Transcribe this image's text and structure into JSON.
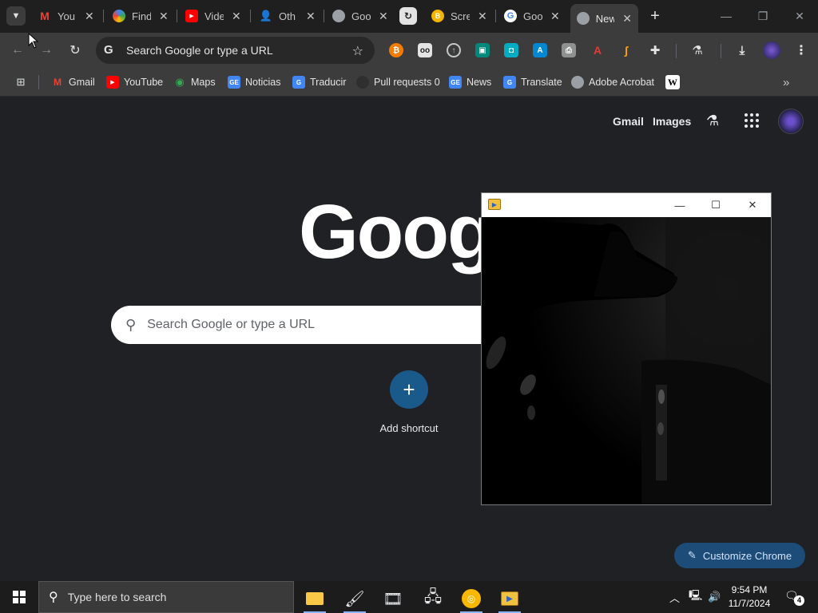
{
  "browser": {
    "tabs": [
      {
        "title": "You",
        "icon": "gmail-icon",
        "color": "#ea4335"
      },
      {
        "title": "Find",
        "icon": "lens-icon",
        "color": "#4285f4"
      },
      {
        "title": "Vide",
        "icon": "youtube-icon",
        "color": "#ff0000"
      },
      {
        "title": "Oth",
        "icon": "person-icon",
        "color": "#1a73e8"
      },
      {
        "title": "Goo",
        "icon": "globe-icon",
        "color": "#9aa0a6"
      },
      {
        "title": "",
        "icon": "sync-icon",
        "color": "#e3e3e3"
      },
      {
        "title": "Scre",
        "icon": "blogger-icon",
        "color": "#f4b400"
      },
      {
        "title": "Goo",
        "icon": "google-icon",
        "color": "#4285f4"
      },
      {
        "title": "New",
        "icon": "chrome-icon",
        "color": "#9aa0a6",
        "active": true
      }
    ],
    "new_tab_symbol": "+",
    "omnibox": {
      "placeholder": "Search Google or type a URL"
    },
    "bookmarks": [
      {
        "label": "Gmail",
        "icon": "gmail-icon",
        "color": "#ea4335"
      },
      {
        "label": "YouTube",
        "icon": "youtube-icon",
        "color": "#ff0000"
      },
      {
        "label": "Maps",
        "icon": "maps-icon",
        "color": "#34a853"
      },
      {
        "label": "Noticias",
        "icon": "news-icon",
        "color": "#4285f4"
      },
      {
        "label": "Traducir",
        "icon": "translate-icon",
        "color": "#4285f4"
      },
      {
        "label": "Pull requests 0",
        "icon": "github-icon",
        "color": "#24292e"
      },
      {
        "label": "News",
        "icon": "news-icon",
        "color": "#4285f4"
      },
      {
        "label": "Translate",
        "icon": "translate-icon",
        "color": "#4285f4"
      },
      {
        "label": "Adobe Acrobat",
        "icon": "globe-icon",
        "color": "#9aa0a6"
      },
      {
        "label": "",
        "icon": "wikipedia-icon",
        "color": "#ffffff"
      }
    ]
  },
  "ntp": {
    "header_links": {
      "gmail": "Gmail",
      "images": "Images"
    },
    "logo_text": "Google",
    "search_placeholder": "Search Google or type a URL",
    "shortcut_plus": "+",
    "shortcut_label": "Add shortcut",
    "customize_label": "Customize Chrome"
  },
  "video_window": {
    "icon": "media-player-icon"
  },
  "taskbar": {
    "search_placeholder": "Type here to search",
    "time": "9:54 PM",
    "date": "11/7/2024",
    "notification_count": "4"
  },
  "colors": {
    "accent": "#1d4c78",
    "page_bg": "#202124"
  }
}
